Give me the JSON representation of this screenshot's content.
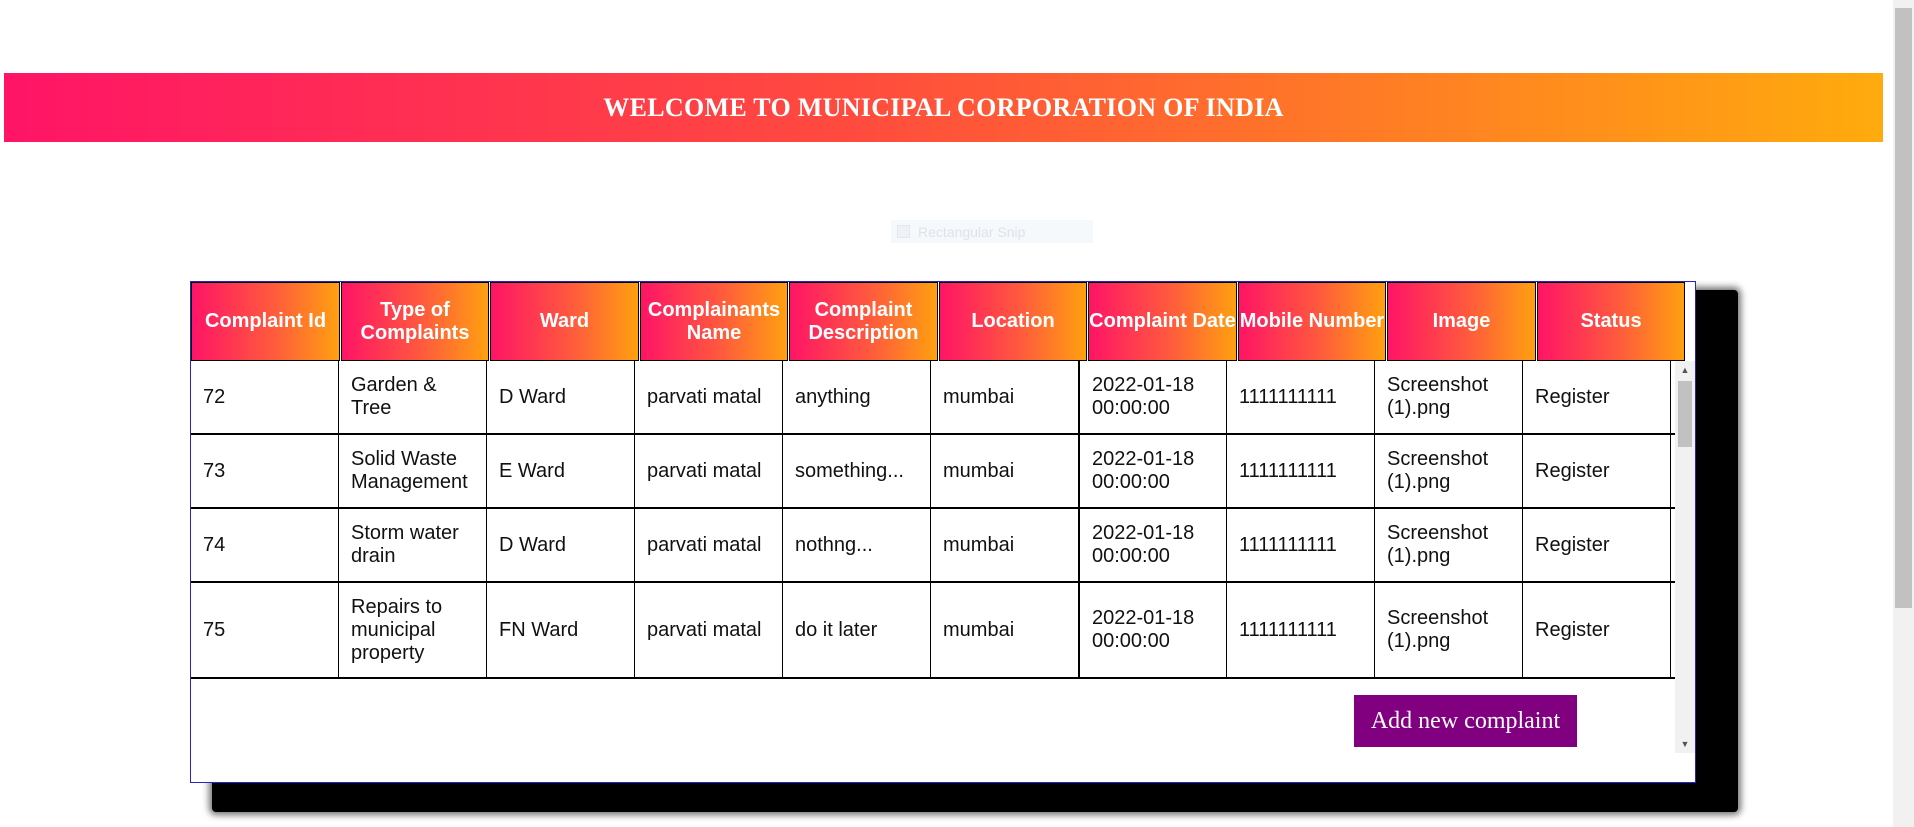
{
  "banner": {
    "title": "WELCOME TO MUNICIPAL CORPORATION OF INDIA"
  },
  "overlay": {
    "snip_label": "Rectangular Snip"
  },
  "table": {
    "headers": [
      "Complaint Id",
      "Type of Complaints",
      "Ward",
      "Complainants Name",
      "Complaint Description",
      "Location",
      "Complaint Date",
      "Mobile Number",
      "Image",
      "Status"
    ],
    "rows": [
      [
        "72",
        "Garden & Tree",
        "D Ward",
        "parvati matal",
        "anything",
        "mumbai",
        "2022-01-18 00:00:00",
        "1111111111",
        "Screenshot (1).png",
        "Register"
      ],
      [
        "73",
        "Solid Waste Management",
        "E Ward",
        "parvati matal",
        "something...",
        "mumbai",
        "2022-01-18 00:00:00",
        "1111111111",
        "Screenshot (1).png",
        "Register"
      ],
      [
        "74",
        "Storm water drain",
        "D Ward",
        "parvati matal",
        "nothng...",
        "mumbai",
        "2022-01-18 00:00:00",
        "1111111111",
        "Screenshot (1).png",
        "Register"
      ],
      [
        "75",
        "Repairs to municipal property",
        "FN Ward",
        "parvati matal",
        "do it later",
        "mumbai",
        "2022-01-18 00:00:00",
        "1111111111",
        "Screenshot (1).png",
        "Register"
      ]
    ]
  },
  "actions": {
    "add_label": "Add new complaint"
  },
  "colors": {
    "accent_pink": "#ff1466",
    "accent_orange": "#ffab0d",
    "button_purple": "#800080"
  }
}
